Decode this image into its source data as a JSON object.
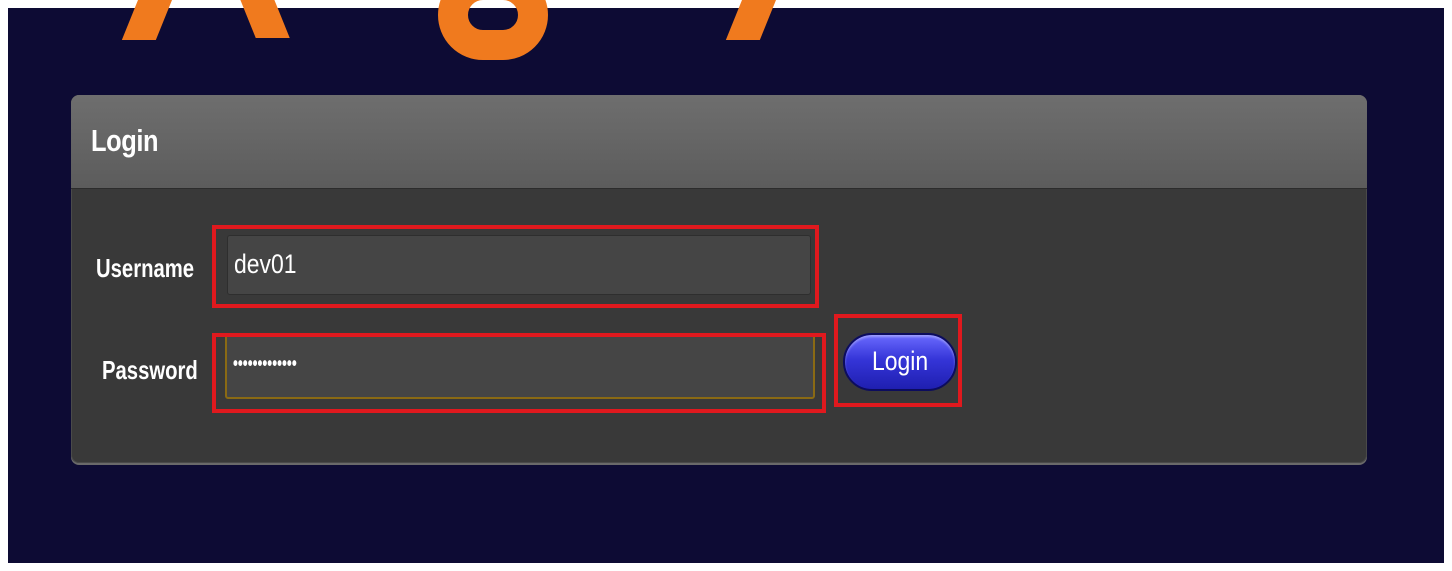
{
  "watermark": {
    "color": "#f07a1e"
  },
  "login_panel": {
    "title": "Login",
    "username_label": "Username",
    "username_value": "dev01",
    "password_label": "Password",
    "password_value": "•••••••••••••",
    "submit_label": "Login"
  },
  "annotations": {
    "highlight_color": "#e0191e"
  },
  "colors": {
    "background": "#0d0b34",
    "panel": "#393939",
    "button": "#3535d8"
  }
}
